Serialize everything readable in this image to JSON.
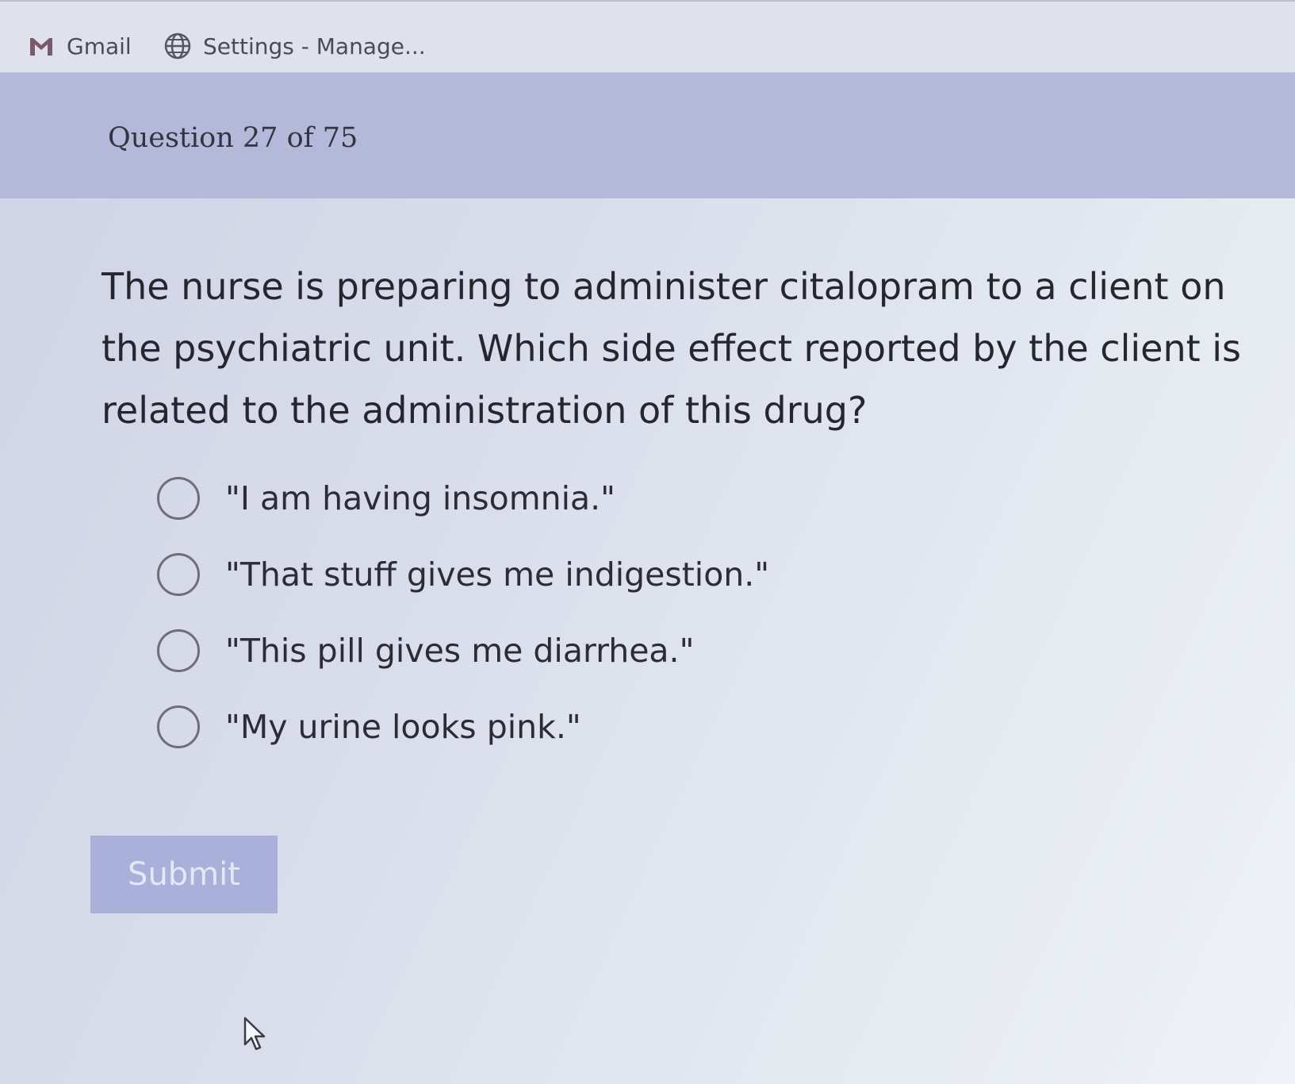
{
  "bookmarks": [
    {
      "label": "Gmail",
      "icon": "gmail-icon"
    },
    {
      "label": "Settings - Manage...",
      "icon": "globe-icon"
    }
  ],
  "question": {
    "counter": "Question 27 of 75",
    "text": "The nurse is preparing to administer citalopram to a client on the psychiatric unit. Which side effect reported by the client is related to the administration of this drug?",
    "options": [
      "\"I am having insomnia.\"",
      "\"That stuff gives me indigestion.\"",
      "\"This pill gives me diarrhea.\"",
      "\"My urine looks pink.\""
    ],
    "selected_index": null
  },
  "submit": {
    "label": "Submit",
    "enabled": false
  },
  "colors": {
    "header_band": "#b4b9da",
    "submit_button": "#a9b0da",
    "submit_text": "#e4e7f6",
    "gmail_red": "#c5221f"
  }
}
